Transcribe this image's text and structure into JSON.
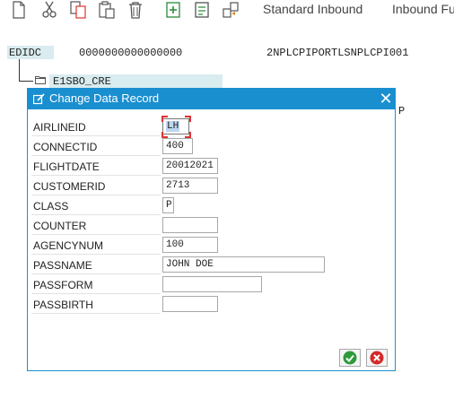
{
  "toolbar": {
    "icons": [
      "new-document-icon",
      "cut-icon",
      "copy-icon",
      "paste-icon",
      "delete-icon",
      "add-segment-icon",
      "edit-segment-icon",
      "transfer-icon"
    ],
    "tab_standard_inbound": "Standard Inbound",
    "tab_inbound_fu": "Inbound Fu"
  },
  "background": {
    "edidc_label": "EDIDC",
    "docnum": "0000000000000000",
    "partner": "2NPLCPIPORTLSNPLCPI001",
    "segment": "E1SBO_CRE",
    "trailing_value": "P"
  },
  "dialog": {
    "title": "Change Data Record",
    "fields": [
      {
        "label": "AIRLINEID",
        "value": "LH"
      },
      {
        "label": "CONNECTID",
        "value": "400"
      },
      {
        "label": "FLIGHTDATE",
        "value": "20012021"
      },
      {
        "label": "CUSTOMERID",
        "value": "2713"
      },
      {
        "label": "CLASS",
        "value": "P"
      },
      {
        "label": "COUNTER",
        "value": ""
      },
      {
        "label": "AGENCYNUM",
        "value": "100"
      },
      {
        "label": "PASSNAME",
        "value": "JOHN DOE"
      },
      {
        "label": "PASSFORM",
        "value": ""
      },
      {
        "label": "PASSBIRTH",
        "value": ""
      }
    ],
    "accent_color": "#1a8fd0"
  }
}
